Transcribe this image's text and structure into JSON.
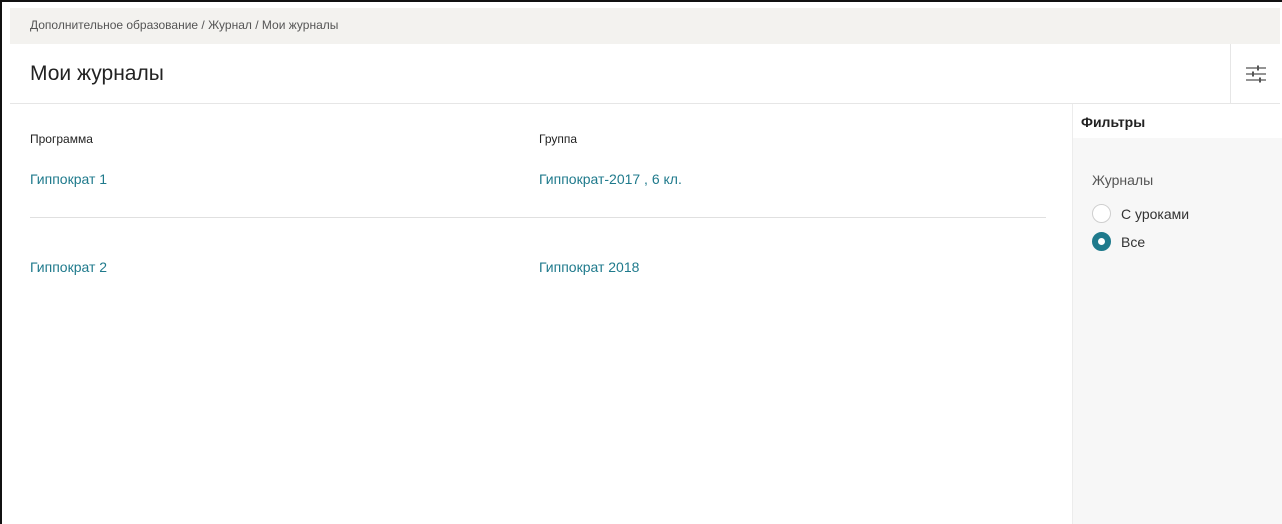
{
  "breadcrumb": {
    "items": [
      "Дополнительное образование",
      "Журнал",
      "Мои журналы"
    ],
    "separator": " / "
  },
  "header": {
    "title": "Мои журналы",
    "filter_icon": "sliders-icon"
  },
  "table": {
    "columns": [
      "Программа",
      "Группа"
    ],
    "rows": [
      {
        "program": "Гиппократ 1",
        "group": "Гиппократ-2017 , 6 кл."
      },
      {
        "program": "Гиппократ 2",
        "group": "Гиппократ 2018"
      }
    ]
  },
  "filters": {
    "title": "Фильтры",
    "group_label": "Журналы",
    "options": [
      {
        "label": "С уроками",
        "selected": false
      },
      {
        "label": "Все",
        "selected": true
      }
    ]
  },
  "colors": {
    "accent": "#1f7a8c",
    "breadcrumb_bg": "#f3f2ef",
    "sidebar_bg": "#f7f7f7"
  }
}
